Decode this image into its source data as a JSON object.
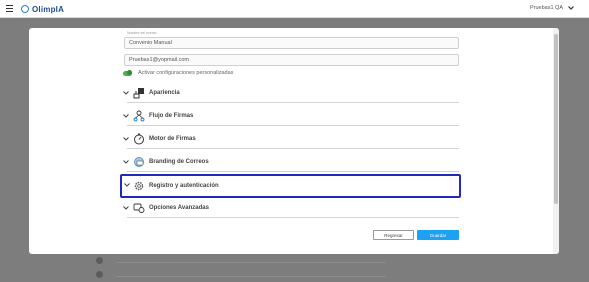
{
  "app": {
    "logo_text": "OlimpIA",
    "user_name": "Pruebas1 QA"
  },
  "form": {
    "field_label": "Nombre del evento",
    "name_value": "Convenio Manual",
    "email_value": "Pruebas1@yopmail.com",
    "toggle_label": "Activar configuraciones personalizadas",
    "toggle_on": true
  },
  "sections": [
    {
      "label": "Apariencia",
      "icon": "appearance-icon"
    },
    {
      "label": "Flujo de Firmas",
      "icon": "signature-flow-icon"
    },
    {
      "label": "Motor de Firmas",
      "icon": "signature-engine-icon"
    },
    {
      "label": "Branding de Correos",
      "icon": "email-branding-icon"
    },
    {
      "label": "Registro y autenticación",
      "icon": "auth-gear-icon",
      "highlighted": true
    },
    {
      "label": "Opciones Avanzadas",
      "icon": "advanced-options-icon"
    }
  ],
  "actions": {
    "back_label": "Regresar",
    "save_label": "Guardar"
  },
  "colors": {
    "accent": "#1da1f2",
    "highlight_border": "#1f2bb8",
    "toggle": "#4caf50",
    "overlay": "#7d7d7d"
  }
}
